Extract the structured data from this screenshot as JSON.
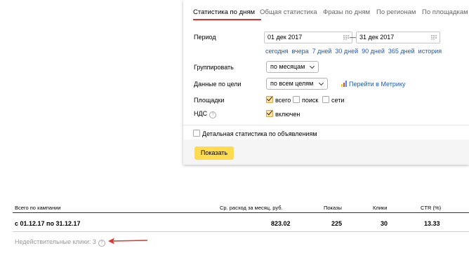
{
  "tabs": [
    {
      "label": "Статистика по дням",
      "active": true
    },
    {
      "label": "Общая статистика",
      "active": false
    },
    {
      "label": "Фразы по дням",
      "active": false
    },
    {
      "label": "По регионам",
      "active": false
    },
    {
      "label": "По площадкам",
      "active": false
    }
  ],
  "filters": {
    "period_label": "Период",
    "date_from": "01 дек 2017",
    "date_to": "31 дек 2017",
    "dash": "—",
    "quick_periods": [
      "сегодня",
      "вчера",
      "7 дней",
      "30 дней",
      "90 дней",
      "365 дней",
      "история"
    ],
    "group_label": "Группировать",
    "group_value": "по месяцам",
    "goals_label": "Данные по цели",
    "goals_value": "по всем целям",
    "metrika_link": "Перейти в Метрику",
    "sites_label": "Площадки",
    "sites": [
      {
        "label": "всего",
        "checked": true
      },
      {
        "label": "поиск",
        "checked": false
      },
      {
        "label": "сети",
        "checked": false
      }
    ],
    "vat_label": "НДС",
    "vat_help": "?",
    "vat_checkbox": {
      "label": "включен",
      "checked": true
    },
    "detail_checkbox": {
      "label": "Детальная статистика по объявлениям",
      "checked": false
    },
    "show_button": "Показать"
  },
  "table": {
    "headers": [
      "Всего по кампании",
      "Ср. расход за месяц, руб.",
      "Показы",
      "Клики",
      "CTR (%)"
    ],
    "row": {
      "period": "с 01.12.17 по 31.12.17",
      "avg_spend": "823.02",
      "impressions": "225",
      "clicks": "30",
      "ctr": "13.33"
    },
    "invalid_clicks": "Недействительные клики: 3",
    "invalid_help": "?"
  },
  "colors": {
    "accent_red": "#d9332b",
    "button_yellow": "#ffdb4d",
    "link_blue": "#1a5bbf",
    "arrow_red": "#e0332b"
  }
}
